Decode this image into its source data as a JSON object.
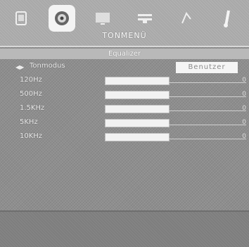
{
  "menu": {
    "title": "TONMENÜ",
    "icons": [
      "picture-icon",
      "sound-icon",
      "tv-icon",
      "settings-icon",
      "source-icon",
      "function-icon"
    ]
  },
  "equalizer": {
    "title": "Equalizer",
    "mode_label": "Tonmodus",
    "mode_value": "Benutzer",
    "bands": [
      {
        "label": "120Hz",
        "value": "0"
      },
      {
        "label": "500Hz",
        "value": "0"
      },
      {
        "label": "1.5KHz",
        "value": "0"
      },
      {
        "label": "5KHz",
        "value": "0"
      },
      {
        "label": "10KHz",
        "value": "0"
      }
    ]
  },
  "colors": {
    "background": "#8e8e8e",
    "topbar": "#a9a9a9",
    "highlight": "#f4f4f4"
  }
}
